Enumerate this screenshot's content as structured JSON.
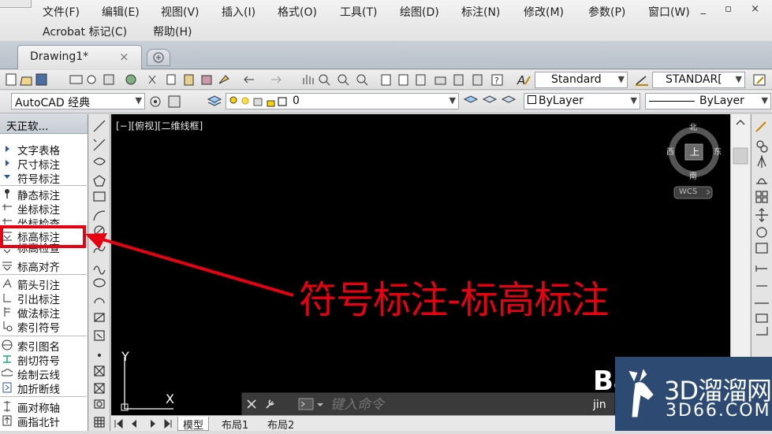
{
  "menubar": {
    "items": [
      "文件(F)",
      "编辑(E)",
      "视图(V)",
      "插入(I)",
      "格式(O)",
      "工具(T)",
      "绘图(D)",
      "标注(N)",
      "修改(M)",
      "参数(P)",
      "窗口(W)",
      "Acrobat 标记(C)",
      "帮助(H)"
    ],
    "window_controls": "_ ▫ ×"
  },
  "tabs": {
    "doc_title": "Drawing1*",
    "close": "×"
  },
  "toolbar1": {
    "text_style": "Standard",
    "dim_style": "STANDAR["
  },
  "toolbar2": {
    "workspace": "AutoCAD 经典",
    "layer": "0",
    "color": "ByLayer",
    "linetype": "ByLayer"
  },
  "palette": {
    "title": "天正软...",
    "items": [
      {
        "label": "文字表格",
        "icon": "triangle-right-icon"
      },
      {
        "label": "尺寸标注",
        "icon": "triangle-right-icon"
      },
      {
        "label": "符号标注",
        "icon": "triangle-down-icon"
      },
      {
        "label": "静态标注",
        "icon": "pin-icon"
      },
      {
        "label": "坐标标注",
        "icon": "coord-icon"
      },
      {
        "label": "坐标检查",
        "icon": "coord-check-icon"
      },
      {
        "label": "标高标注",
        "icon": "elevation-icon"
      },
      {
        "label": "标高检查",
        "icon": "elevation-check-icon"
      },
      {
        "label": "标高对齐",
        "icon": "elevation-align-icon"
      },
      {
        "label": "箭头引注",
        "icon": "arrow-note-icon"
      },
      {
        "label": "引出标注",
        "icon": "leader-icon"
      },
      {
        "label": "做法标注",
        "icon": "method-icon"
      },
      {
        "label": "索引符号",
        "icon": "index-symbol-icon"
      },
      {
        "label": "索引图名",
        "icon": "index-name-icon"
      },
      {
        "label": "剖切符号",
        "icon": "section-icon"
      },
      {
        "label": "绘制云线",
        "icon": "cloud-icon"
      },
      {
        "label": "加折断线",
        "icon": "break-line-icon"
      },
      {
        "label": "画对称轴",
        "icon": "symmetry-axis-icon"
      },
      {
        "label": "画指北针",
        "icon": "north-arrow-icon"
      }
    ]
  },
  "viewport": {
    "label": "[−][俯视][二维线框]",
    "viewcube": {
      "north": "北",
      "south": "南",
      "east": "东",
      "west": "西",
      "face": "上",
      "wcs": "WCS"
    },
    "ucs": {
      "x": "X",
      "y": "Y"
    },
    "annotation": "符号标注-标高标注",
    "annotation_color": "#e60012",
    "highlight_color": "#e60012"
  },
  "command": {
    "placeholder": "键入命令"
  },
  "layout_tabs": [
    "模型",
    "布局1",
    "布局2"
  ],
  "watermark": {
    "brand": "3D溜溜网",
    "url": "3D66.COM",
    "partial_text": "Bai",
    "partial_text2": "jin"
  }
}
